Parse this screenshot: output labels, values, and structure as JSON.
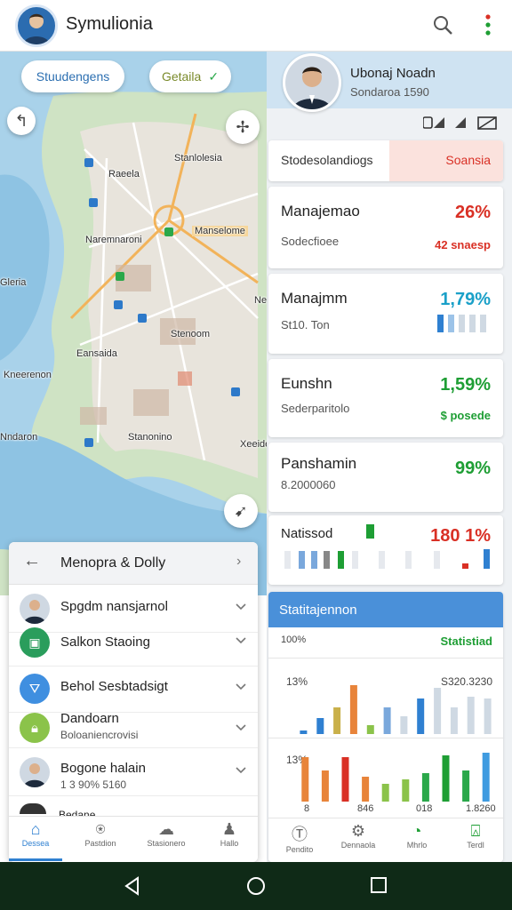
{
  "app": {
    "title": "Symulionia"
  },
  "map": {
    "filter_chip": "Stuudengens",
    "details_chip": "Getaila",
    "labels": {
      "l1": "Stanlolesia",
      "l2": "Raeela",
      "l3": "Naremnaroni",
      "l4": "Manselome",
      "l5": "Stenoom",
      "l6": "Eansaida",
      "l7": "Kneerenon",
      "l8": "Nndaron",
      "l9": "Stanonino",
      "l10": "Xeeide",
      "l11": "Gleria",
      "l12": "Nes"
    }
  },
  "profile": {
    "name": "Ubonaj Noadn",
    "subtitle": "Sondaroa 1590"
  },
  "cards": {
    "header": {
      "label": "Stodesolandiogs",
      "value": "Soansia"
    },
    "c1": {
      "title": "Manajemao",
      "sub": "Sodecfioee",
      "value": "26%",
      "sub_value": "42 snaesp"
    },
    "c2": {
      "title": "Manajmm",
      "sub": "St10. Ton",
      "value": "1,79%"
    },
    "c3": {
      "title": "Eunshn",
      "sub": "Sederparitolo",
      "value": "1,59%",
      "sub_value": "$ posede"
    },
    "c4": {
      "title": "Panshamin",
      "sub": "8.2000060",
      "value": "99%"
    },
    "c5": {
      "title": "Natissod",
      "value": "180 1%"
    }
  },
  "stats": {
    "header": "Statitajennon",
    "sub_left": "100%",
    "sub_right": "Statistiad",
    "chart1": {
      "left_label": "13%",
      "right_label": "S320.3230",
      "values": [
        4,
        18,
        30,
        55,
        10,
        30,
        20,
        40,
        52,
        30,
        42,
        40
      ]
    },
    "chart2": {
      "left_label": "13%",
      "values": [
        50,
        35,
        50,
        28,
        20,
        25,
        32,
        52,
        35,
        55
      ],
      "x_labels": [
        "8",
        "846",
        "018",
        "1.8260"
      ]
    }
  },
  "menu": {
    "title": "Menopra & Dolly",
    "items": [
      {
        "label": "Spgdm nansjarnol",
        "sub": ""
      },
      {
        "label": "Salkon Staoing",
        "sub": ""
      },
      {
        "label": "Behol Sesbtadsigt",
        "sub": ""
      },
      {
        "label": "Dandoarn",
        "sub": "Boloaniencrovisi"
      },
      {
        "label": "Bogone halain",
        "sub": "1 3 90% 5160"
      }
    ],
    "partial": "Bedane"
  },
  "bottom_nav": {
    "left": [
      "Dessea",
      "Pastdion",
      "Stasionero",
      "Hallo"
    ],
    "right": [
      "Pendito",
      "Dennaola",
      "Mhrlo",
      "Terdl"
    ]
  },
  "colors": {
    "accent": "#2f80d1",
    "red": "#d93025",
    "green": "#1e9e34",
    "teal": "#1aa0c8"
  }
}
